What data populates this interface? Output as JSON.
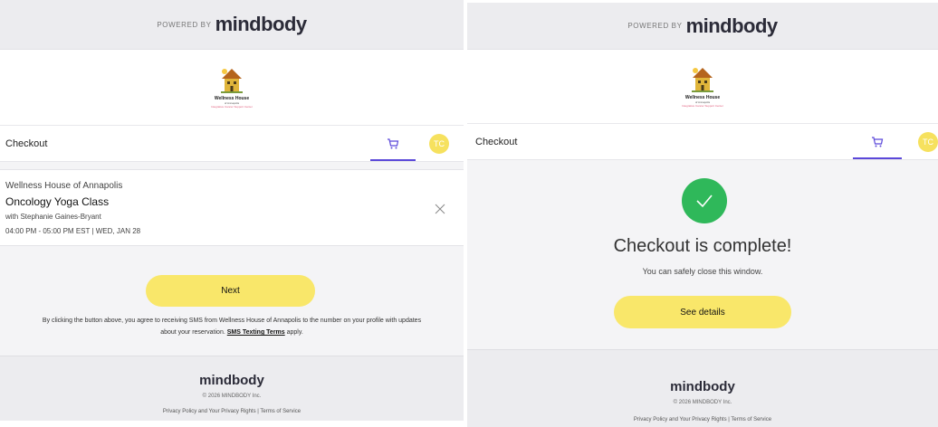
{
  "left": {
    "powered_by": "POWERED BY",
    "brand": "mindbody",
    "logo": {
      "name": "Wellness House",
      "sub": "of Annapolis",
      "tag": "Integrative Cancer Support Center"
    },
    "nav": {
      "title": "Checkout",
      "avatar_initials": "TC"
    },
    "booking": {
      "studio": "Wellness House of Annapolis",
      "class_name": "Oncology Yoga Class",
      "teacher": "with Stephanie Gaines-Bryant",
      "time": "04:00 PM - 05:00 PM EST | WED, JAN 28"
    },
    "next_button": "Next",
    "legal": {
      "line1": "By clicking the button above, you agree to receiving SMS from Wellness House of Annapolis to the number on your profile with updates",
      "line2_pre": "about your reservation.",
      "link": "SMS Texting Terms",
      "line2_post": "apply."
    },
    "footer": {
      "brand": "mindbody",
      "copyright": "© 2026 MINDBODY Inc.",
      "privacy": "Privacy Policy and Your Privacy Rights",
      "separator": "|",
      "terms": "Terms of Service"
    }
  },
  "right": {
    "powered_by": "POWERED BY",
    "brand": "mindbody",
    "logo": {
      "name": "Wellness House",
      "sub": "of Annapolis",
      "tag": "Integrative Cancer Support Center"
    },
    "nav": {
      "title": "Checkout",
      "avatar_initials": "TC"
    },
    "complete_title": "Checkout is complete!",
    "complete_sub": "You can safely close this window.",
    "details_button": "See details",
    "footer": {
      "brand": "mindbody",
      "copyright": "© 2026 MINDBODY Inc.",
      "privacy": "Privacy Policy and Your Privacy Rights",
      "separator": "|",
      "terms": "Terms of Service"
    }
  },
  "colors": {
    "accent": "#5b48d9",
    "button": "#f9e76a",
    "avatar": "#f6e15e",
    "success": "#2fb85a",
    "page_bg": "#f4f4f6"
  },
  "icons": {
    "cart": "shopping-cart-icon",
    "close": "close-icon",
    "check": "checkmark-icon"
  }
}
